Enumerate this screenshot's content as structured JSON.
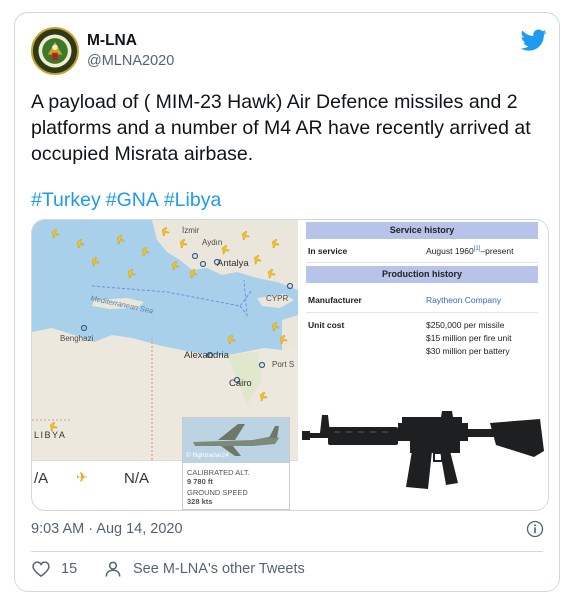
{
  "author": {
    "display_name": "M-LNA",
    "handle": "@MLNA2020",
    "avatar_icon": "emblem-avatar-icon"
  },
  "platform_icon": "twitter-bird-icon",
  "tweet": {
    "text": "A payload of ( MIM-23 Hawk) Air Defence missiles and 2 platforms  and a number of M4 AR have recently arrived at occupied Misrata airbase.",
    "hashtags": [
      "#Turkey",
      "#GNA",
      "#Libya"
    ]
  },
  "media": {
    "map": {
      "labels": {
        "izmir": "İzmir",
        "aydin": "Aydın",
        "antalya": "Antalya",
        "cyprus": "CYPR",
        "mediterranean_sea": "Mediterranean Sea",
        "benghazi": "Benghazi",
        "alexandria": "Alexandria",
        "port_said": "Port S",
        "cairo": "Cairo",
        "libya": "LIBYA"
      },
      "flight_bar": {
        "left_value": "/A",
        "right_value": "N/A"
      },
      "flight_popup": {
        "credit": "© flightradar24",
        "calibrated_alt_label": "CALIBRATED ALT.",
        "calibrated_alt_value": "9 780 ft",
        "ground_speed_label": "GROUND SPEED",
        "ground_speed_value": "328 kts"
      }
    },
    "infobox": {
      "service_history_title": "Service history",
      "in_service_label": "In service",
      "in_service_value": "August 1960",
      "in_service_ref": "[1]",
      "in_service_suffix": "–present",
      "production_history_title": "Production history",
      "manufacturer_label": "Manufacturer",
      "manufacturer_value": "Raytheon Company",
      "unit_cost_label": "Unit cost",
      "unit_cost_values": [
        "$250,000 per missile",
        "$15 million per fire unit",
        "$30 million per battery"
      ]
    }
  },
  "footer": {
    "timestamp": "9:03 AM · Aug 14, 2020",
    "like_count": "15",
    "profile_link": "See M-LNA's other Tweets"
  },
  "colors": {
    "accent": "#1d9bf0",
    "text_primary": "#0f1419",
    "text_secondary": "#536471",
    "like_red": "#f91880",
    "border": "#cfd9de"
  }
}
